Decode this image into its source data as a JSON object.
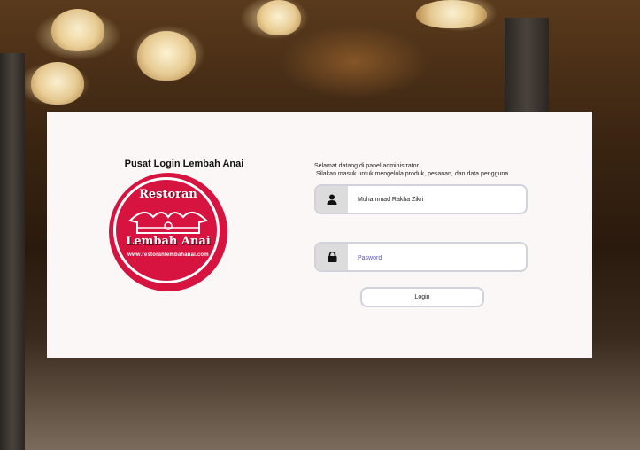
{
  "login": {
    "title": "Pusat Login Lembah Anai",
    "welcome_line1": "Selamat datang di panel administrator.",
    "welcome_line2": "Silakan masuk untuk mengelola produk, pesanan, dan data pengguna.",
    "username_value": "Muhammad Rakha Zikri",
    "password_placeholder": "Pasword",
    "login_button": "Login"
  },
  "logo": {
    "line1": "Restoran",
    "line2": "Lembah Anai",
    "url": "www.restoranlembahanai.com"
  },
  "icons": {
    "user": "user-icon",
    "lock": "lock-icon"
  },
  "colors": {
    "brand_red": "#d7133f",
    "card_bg": "#fcf7f7",
    "placeholder": "#5a5ac0"
  }
}
